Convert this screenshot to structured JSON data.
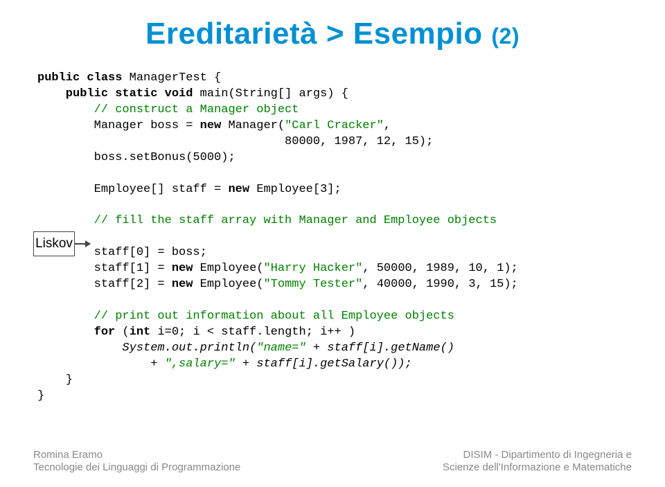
{
  "title_main": "Ereditarietà > Esempio ",
  "title_small": "(2)",
  "liskov_label": "Liskov",
  "code": {
    "l1a": "public",
    "l1b": " class",
    "l1c": " ManagerTest {",
    "l2a": "    public",
    "l2b": " static",
    "l2c": " void",
    "l2d": " main(String[] args) {",
    "l3c": "        // construct a Manager object",
    "l4a": "        Manager boss = ",
    "l4b": "new",
    "l4c": " Manager(",
    "l4s": "\"Carl Cracker\"",
    "l4d": ",",
    "l5": "                                   80000, 1987, 12, 15);",
    "l6": "        boss.setBonus(5000);",
    "l7": "",
    "l8a": "        Employee[] staff = ",
    "l8b": "new",
    "l8c": " Employee[3];",
    "l9": "",
    "l10c": "        // fill the staff array with Manager and Employee objects",
    "l11": "",
    "l12": "        staff[0] = boss;",
    "l13a": "        staff[1] = ",
    "l13b": "new",
    "l13c": " Employee(",
    "l13s": "\"Harry Hacker\"",
    "l13d": ", 50000, 1989, 10, 1);",
    "l14a": "        staff[2] = ",
    "l14b": "new",
    "l14c": " Employee(",
    "l14s": "\"Tommy Tester\"",
    "l14d": ", 40000, 1990, 3, 15);",
    "l15": "",
    "l16c": "        // print out information about all Employee objects",
    "l17a": "        for",
    "l17b": " (",
    "l17c": "int",
    "l17d": " i=0; i < staff.length; i++ )",
    "l18a": "            System.",
    "l18b": "out",
    "l18c": ".println(",
    "l18s1": "\"name=\"",
    "l18d": " + staff[i].getName()",
    "l19a": "                + ",
    "l19s": "\",salary=\"",
    "l19b": " + staff[i].getSalary());",
    "l20": "    }",
    "l21": "}"
  },
  "footer": {
    "left1": "Romina Eramo",
    "left2": "Tecnologie dei Linguaggi di Programmazione",
    "right1": "DISIM - Dipartimento di Ingegneria e",
    "right2": "Scienze dell'Informazione e Matematiche"
  }
}
